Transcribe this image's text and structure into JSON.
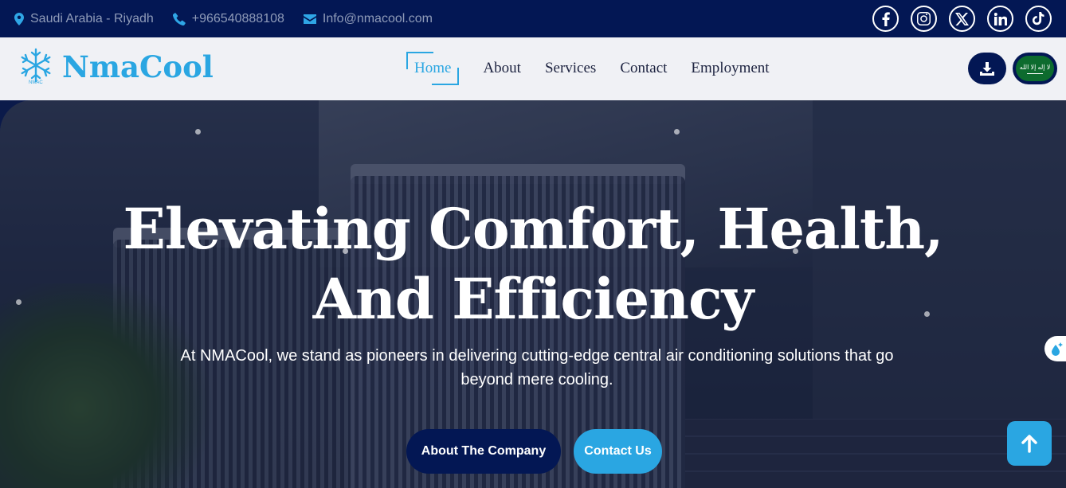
{
  "topbar": {
    "location": "Saudi Arabia - Riyadh",
    "phone": "+966540888108",
    "email": "Info@nmacool.com",
    "social_icons": [
      "facebook-icon",
      "instagram-icon",
      "x-icon",
      "linkedin-icon",
      "tiktok-icon"
    ]
  },
  "header": {
    "logo_text": "NmaCool",
    "logo_sub": "NMAC",
    "nav": [
      {
        "label": "Home",
        "active": true
      },
      {
        "label": "About"
      },
      {
        "label": "Services"
      },
      {
        "label": "Contact"
      },
      {
        "label": "Employment"
      }
    ],
    "flag_text": "لا إله إلا الله"
  },
  "hero": {
    "headline_line1": "Elevating Comfort, Health,",
    "headline_line2": "And Efficiency",
    "subtitle": "At NMACool, we stand as pioneers in delivering cutting-edge central air conditioning solutions that go beyond mere cooling.",
    "btn_about": "About The Company",
    "btn_contact": "Contact Us"
  },
  "colors": {
    "navy": "#031754",
    "accent": "#2aa6e2",
    "nav_bg": "#f0f1f5"
  }
}
